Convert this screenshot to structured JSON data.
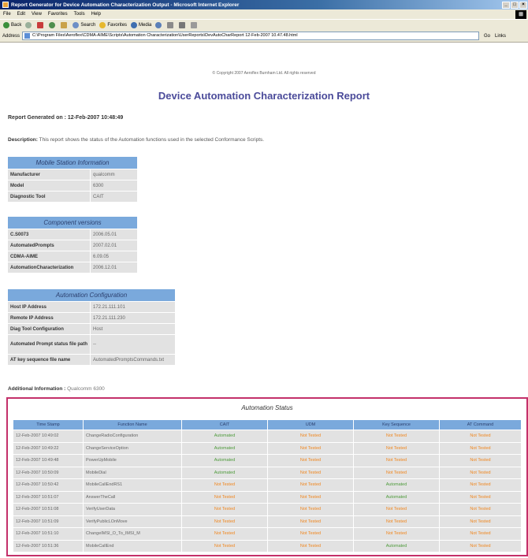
{
  "window": {
    "title": "Report Generator for Device Automation Characterization Output - Microsoft Internet Explorer"
  },
  "menu": [
    "File",
    "Edit",
    "View",
    "Favorites",
    "Tools",
    "Help"
  ],
  "toolbar": {
    "back_label": "Back",
    "search_label": "Search",
    "favorites_label": "Favorites",
    "media_label": "Media"
  },
  "address": {
    "label": "Address",
    "value": "C:\\Program Files\\Aeroflex\\CDMA-AIME\\Scripts\\Automation Characterization\\UserReports\\DevAutoCharReport 12-Feb-2007 10.47.48.html",
    "go_label": "Go",
    "links_label": "Links"
  },
  "page": {
    "copyright": "© Copyright 2007 Aeroflex Burnham Ltd. All rights reserved",
    "title": "Device Automation Characterization Report",
    "generated": "Report Generated on : 12-Feb-2007 10:48:49",
    "description_label": "Description:",
    "description_text": "This report shows the status of the Automation functions used in the selected Conformance Scripts.",
    "additional_label": "Additional Information :",
    "additional_value": "Qualcomm 6300"
  },
  "mobile_station": {
    "heading": "Mobile Station Information",
    "rows": [
      {
        "k": "Manufacturer",
        "v": "qualcomm"
      },
      {
        "k": "Model",
        "v": "6300"
      },
      {
        "k": "Diagnostic Tool",
        "v": "CAIT"
      }
    ]
  },
  "components": {
    "heading": "Component versions",
    "rows": [
      {
        "k": "C.S0073",
        "v": "2006.05.01"
      },
      {
        "k": "AutomatedPrompts",
        "v": "2007.02.01"
      },
      {
        "k": "CDMA-AIME",
        "v": "6.09.05"
      },
      {
        "k": "AutomationCharacterization",
        "v": "2006.12.01"
      }
    ]
  },
  "automation_config": {
    "heading": "Automation Configuration",
    "rows": [
      {
        "k": "Host IP Address",
        "v": "172.21.111.101"
      },
      {
        "k": "Remote IP Address",
        "v": "172.21.111.230"
      },
      {
        "k": "Diag Tool Configuration",
        "v": "Host"
      },
      {
        "k": "Automated Prompt status file path",
        "v": "--"
      },
      {
        "k": "AT key sequence file name",
        "v": "AutomatedPromptsCommands.txt"
      }
    ]
  },
  "automation_status": {
    "heading": "Automation Status",
    "columns": [
      "Time Stamp",
      "Function Name",
      "CAIT",
      "UDM",
      "Key Sequence",
      "AT Command"
    ],
    "rows": [
      [
        "12-Feb-2007 10:49:02",
        "ChangeRadioConfiguration",
        "Automated",
        "Not Tested",
        "Not Tested",
        "Not Tested"
      ],
      [
        "12-Feb-2007 10:49:22",
        "ChangeServiceOption",
        "Automated",
        "Not Tested",
        "Not Tested",
        "Not Tested"
      ],
      [
        "12-Feb-2007 10:49:48",
        "PowerUpMobile",
        "Automated",
        "Not Tested",
        "Not Tested",
        "Not Tested"
      ],
      [
        "12-Feb-2007 10:50:09",
        "MobileDial",
        "Automated",
        "Not Tested",
        "Not Tested",
        "Not Tested"
      ],
      [
        "12-Feb-2007 10:50:42",
        "MobileCallEndRS1",
        "Not Tested",
        "Not Tested",
        "Automated",
        "Not Tested"
      ],
      [
        "12-Feb-2007 10:51:07",
        "AnswerTheCall",
        "Not Tested",
        "Not Tested",
        "Automated",
        "Not Tested"
      ],
      [
        "12-Feb-2007 10:51:08",
        "VerifyUserData",
        "Not Tested",
        "Not Tested",
        "Not Tested",
        "Not Tested"
      ],
      [
        "12-Feb-2007 10:51:09",
        "VerifyPublicLOnMove",
        "Not Tested",
        "Not Tested",
        "Not Tested",
        "Not Tested"
      ],
      [
        "12-Feb-2007 10:51:10",
        "ChangeIMSI_O_To_IMSI_M",
        "Not Tested",
        "Not Tested",
        "Not Tested",
        "Not Tested"
      ],
      [
        "12-Feb-2007 10:51:36",
        "MobileCallEnd",
        "Not Tested",
        "Not Tested",
        "Automated",
        "Not Tested"
      ]
    ]
  },
  "colors": {
    "header_blue": "#7aa9dc",
    "title_purple": "#4b4b9a",
    "automated_green": "#4d9a3a",
    "not_tested_orange": "#f0861d",
    "frame_magenta": "#c4306a"
  }
}
